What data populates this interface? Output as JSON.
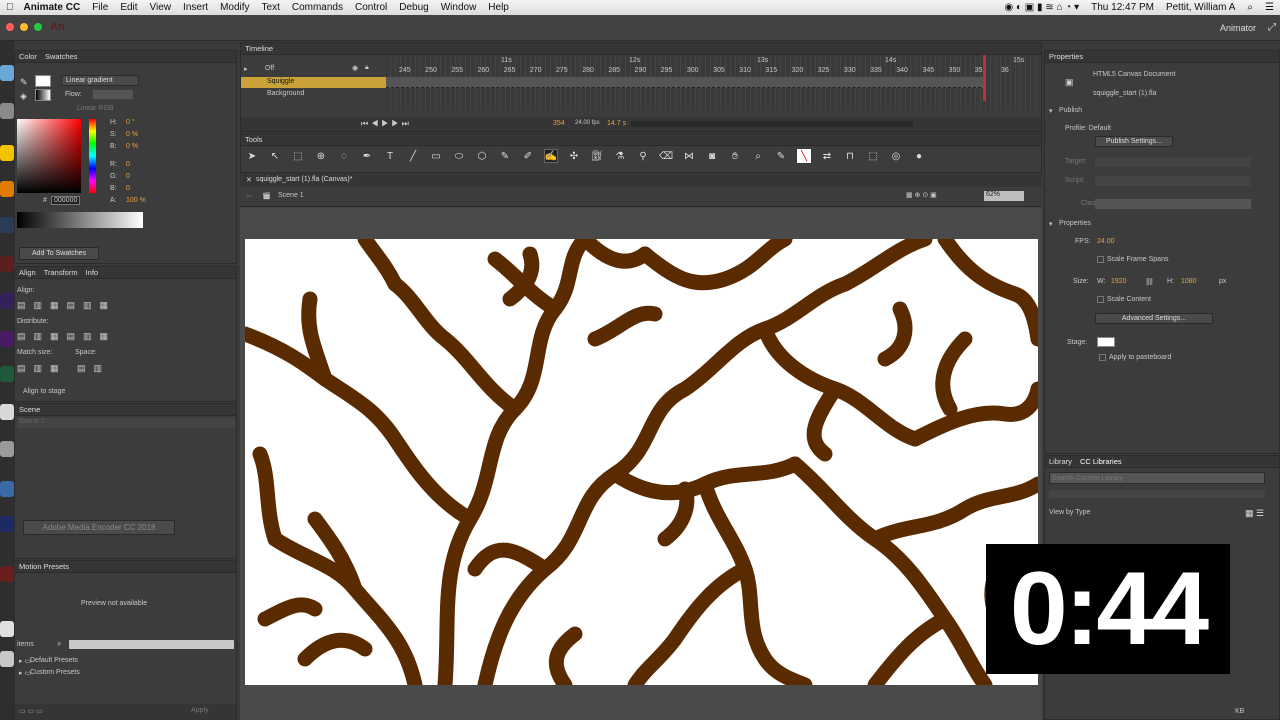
{
  "menubar": {
    "app": "Animate CC",
    "items": [
      "File",
      "Edit",
      "View",
      "Insert",
      "Modify",
      "Text",
      "Commands",
      "Control",
      "Debug",
      "Window",
      "Help"
    ],
    "clock": "Thu 12:47 PM",
    "user": "Pettit, William A"
  },
  "apptitle": {
    "logo": "An",
    "workspace": "Animator"
  },
  "left": {
    "tab_color": "Color",
    "tab_swatches": "Swatches",
    "gradient_type": "Linear gradient",
    "flow": "Flow:",
    "linear_rgb": "Linear RGB",
    "h_label": "H:",
    "h_val": "0 °",
    "s_label": "S:",
    "s_val": "0 %",
    "b_label": "B:",
    "b_val": "0 %",
    "r_label": "R:",
    "r_val": "0",
    "g_label": "G:",
    "g_val": "0",
    "b2_label": "B:",
    "b2_val": "0",
    "hex_label": "#",
    "hex_val": "000000",
    "a_label": "A:",
    "a_val": "100 %",
    "add_swatches": "Add To Swatches",
    "tab_align": "Align",
    "tab_transform": "Transform",
    "tab_info": "Info",
    "align": "Align:",
    "distribute": "Distribute:",
    "match_size": "Match size:",
    "space": "Space:",
    "align_stage": "Align to stage",
    "scene_header": "Scene",
    "scene_item": "Scene 1",
    "encoder": "Adobe Media Encoder CC 2018",
    "motion_presets": "Motion Presets",
    "preview": "Preview not available",
    "items_label": "items",
    "folder1": "Default Presets",
    "folder2": "Custom Presets",
    "apply": "Apply"
  },
  "timeline": {
    "title": "Timeline",
    "onion": "Off",
    "layers": [
      "Squiggle",
      "Background"
    ],
    "seconds": [
      "11s",
      "12s",
      "13s",
      "14s",
      "15s"
    ],
    "frames": [
      "245",
      "250",
      "255",
      "260",
      "265",
      "270",
      "275",
      "280",
      "285",
      "290",
      "295",
      "300",
      "305",
      "310",
      "315",
      "320",
      "325",
      "330",
      "335",
      "340",
      "345",
      "350",
      "355",
      "36"
    ],
    "frame_num": "354",
    "fps_text": "24.00 fps",
    "time": "14.7 s"
  },
  "tools": {
    "title": "Tools"
  },
  "doc": {
    "tab": "squiggle_start (1).fla (Canvas)*",
    "scene": "Scene 1",
    "zoom": "62%"
  },
  "props": {
    "title": "Properties",
    "doc_type": "HTML5 Canvas Document",
    "doc_name": "squiggle_start (1).fla",
    "publish": "Publish",
    "profile": "Profile: Default",
    "publish_settings": "Publish Settings...",
    "target": "Target:",
    "script": "Script:",
    "class": "Class:",
    "properties": "Properties",
    "fps_label": "FPS:",
    "fps": "24.00",
    "scale_spans": "Scale Frame Spans",
    "size_label": "Size:",
    "w_label": "W:",
    "w": "1920",
    "h_label": "H:",
    "h": "1080",
    "px": "px",
    "scale_content": "Scale Content",
    "advanced": "Advanced Settings...",
    "stage": "Stage:",
    "apply_paste": "Apply to pasteboard",
    "library": "Library",
    "cc_libraries": "CC Libraries",
    "search_placeholder": "Search Current Library",
    "view_by": "View by Type",
    "kb": "KB"
  },
  "timer": "0:44",
  "colors": {
    "brown": "#5a2b00",
    "accent": "#e8a33a"
  }
}
